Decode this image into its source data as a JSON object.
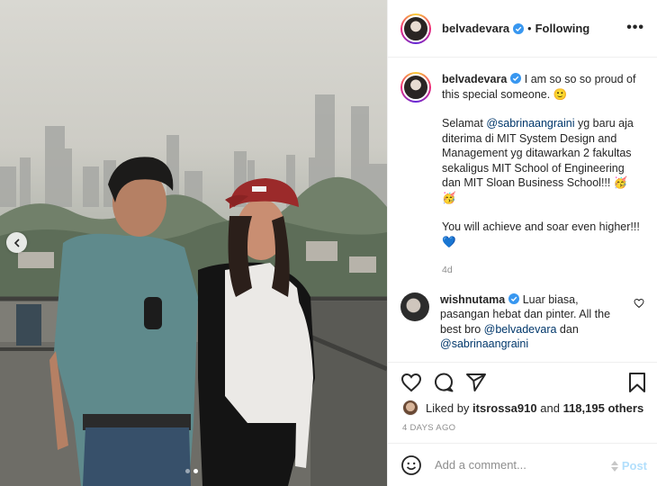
{
  "author": {
    "username": "belvadevara",
    "follow_status": "Following",
    "more_label": "•••"
  },
  "caption": {
    "username": "belvadevara",
    "line1": "I am so so so proud of this special someone. 🙂",
    "p2_pre": "Selamat ",
    "p2_mention": "@sabrinaangraini",
    "p2_post": " yg baru aja diterima di MIT System Design and Management yg ditawarkan 2 fakultas sekaligus MIT School of Engineering dan MIT Sloan Business School!!! 🥳🥳",
    "p3": "You will achieve and soar even higher!!! 💙",
    "time": "4d"
  },
  "comment": {
    "username": "wishnutama",
    "text_pre": "Luar biasa, pasangan hebat dan pinter. All the best bro ",
    "mention1": "@belvadevara",
    "text_mid": " dan ",
    "mention2": "@sabrinaangraini"
  },
  "likes": {
    "prefix": "Liked by ",
    "user": "itsrossa910",
    "mid": " and ",
    "count": "118,195 others"
  },
  "posted_ago": "4 DAYS AGO",
  "add_comment": {
    "placeholder": "Add a comment...",
    "post_label": "Post"
  },
  "colors": {
    "verified": "#3897f0",
    "mention": "#00376b",
    "muted": "#8e8e8e",
    "post_disabled": "#b2dffc"
  },
  "carousel": {
    "total": 2,
    "active": 2
  },
  "icons": [
    "verified-icon",
    "smiley-icon",
    "heart-icon",
    "comment-icon",
    "share-icon",
    "bookmark-icon",
    "emoji-icon",
    "chevron-left-icon"
  ]
}
